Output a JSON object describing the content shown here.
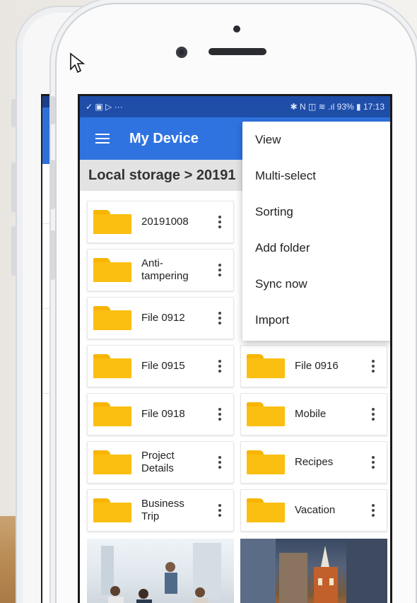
{
  "status_bar": {
    "left_icons": "✓ ▣ ▷ ···",
    "right_status": "✱ N ◫ ≋ .ıl 93% ▮ 17:13"
  },
  "app_bar": {
    "menu_icon": "hamburger-icon",
    "title": "My Device"
  },
  "breadcrumb": {
    "text": "Local storage > 20191"
  },
  "context_menu": {
    "items": [
      {
        "label": "View"
      },
      {
        "label": "Multi-select"
      },
      {
        "label": "Sorting"
      },
      {
        "label": "Add folder"
      },
      {
        "label": "Sync now"
      },
      {
        "label": "Import"
      }
    ]
  },
  "folders": [
    {
      "name": "20191008"
    },
    {
      "name": "Anti-\ntampering"
    },
    {
      "name": "File 0912"
    },
    {
      "name": "File 0915"
    },
    {
      "name": "File 0916"
    },
    {
      "name": "File 0918"
    },
    {
      "name": "Mobile"
    },
    {
      "name": "Project\nDetails"
    },
    {
      "name": "Recipes"
    },
    {
      "name": "Business\nTrip"
    },
    {
      "name": "Vacation"
    }
  ],
  "colors": {
    "status_bar": "#1f4ea9",
    "app_bar": "#2f73e0",
    "folder": "#fbbf12",
    "breadcrumb_bg": "#e3e3e3"
  }
}
